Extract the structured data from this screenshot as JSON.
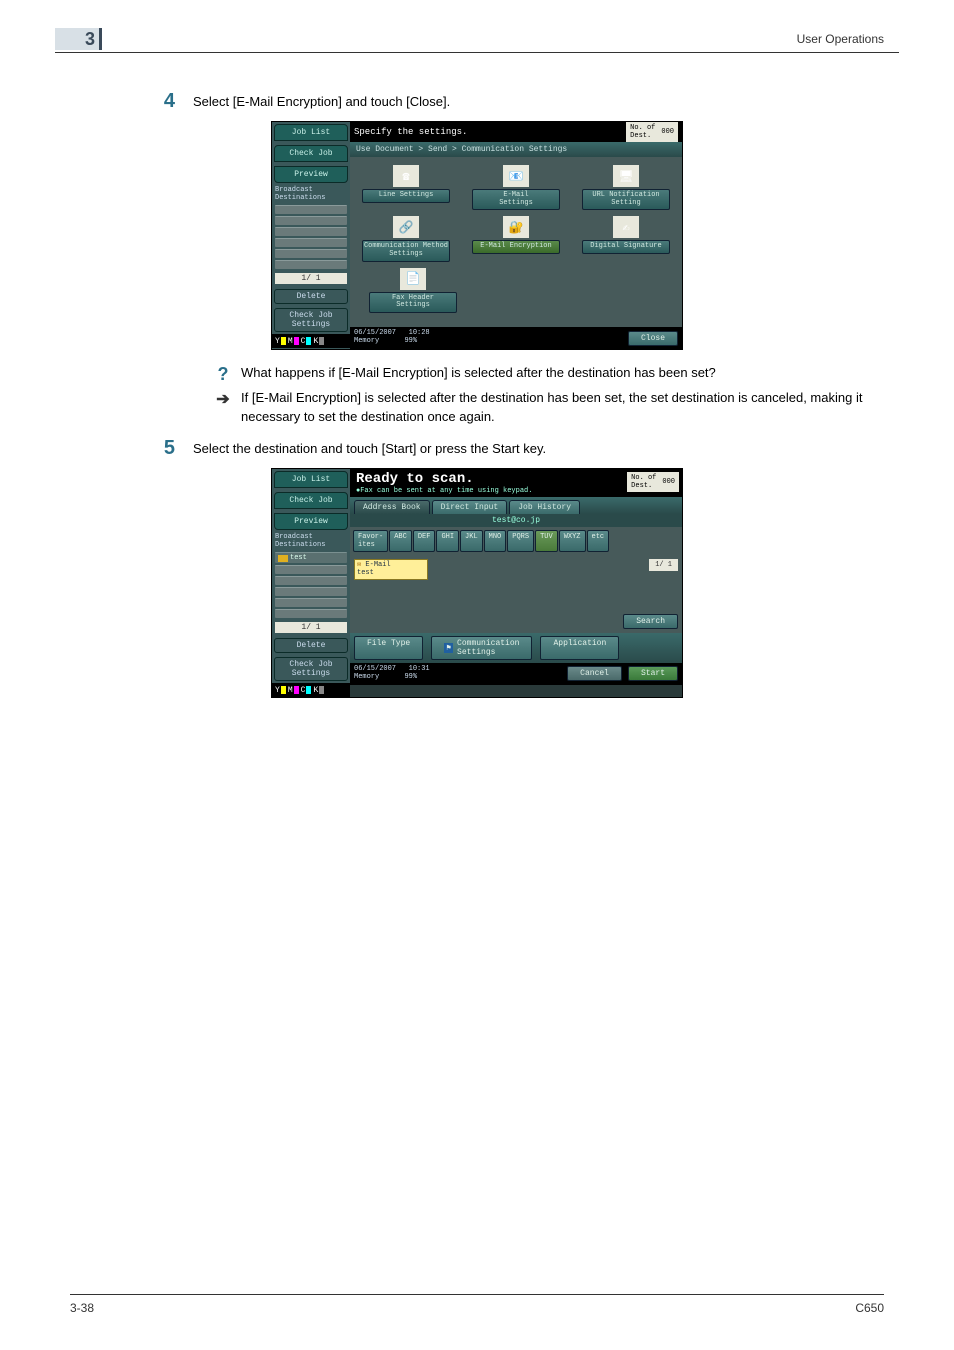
{
  "header": {
    "chapter_number": "3",
    "section_title": "User Operations"
  },
  "step4": {
    "number": "4",
    "text": "Select [E-Mail Encryption] and touch [Close]."
  },
  "screenshot1": {
    "sidebar": {
      "job_list": "Job List",
      "check_job": "Check Job",
      "preview": "Preview",
      "broadcast_label": "Broadcast\nDestinations",
      "page_indicator": "1/  1",
      "delete": "Delete",
      "check_job_settings": "Check Job\nSettings"
    },
    "topbar_title": "Specify the settings.",
    "dest_label": "No. of\nDest.",
    "dest_count": "000",
    "breadcrumb": "Use Document > Send > Communication Settings",
    "icons": {
      "line_settings": "Line Settings",
      "email_settings": "E-Mail\nSettings",
      "url_notif": "URL Notification\nSetting",
      "comm_method": "Communication Method\nSettings",
      "email_encryption": "E-Mail Encryption",
      "digital_signature": "Digital Signature",
      "fax_header": "Fax Header\nSettings"
    },
    "status": {
      "date": "06/15/2007",
      "time": "10:28",
      "memory_label": "Memory",
      "memory_pct": "99%"
    },
    "close": "Close",
    "cmyk": {
      "y": "Y",
      "m": "M",
      "c": "C",
      "k": "K"
    }
  },
  "qa": {
    "question": "What happens if [E-Mail Encryption] is selected after the destination has been set?",
    "answer": "If [E-Mail Encryption] is selected after the destination has been set, the set destination is canceled, making it necessary to set the destination once again."
  },
  "step5": {
    "number": "5",
    "text": "Select the destination and touch [Start] or press the Start key."
  },
  "screenshot2": {
    "sidebar": {
      "job_list": "Job List",
      "check_job": "Check Job",
      "preview": "Preview",
      "broadcast_label": "Broadcast\nDestinations",
      "dest_entry": "test",
      "page_indicator": "1/  1",
      "delete": "Delete",
      "check_job_settings": "Check Job\nSettings"
    },
    "ready_title": "Ready to scan.",
    "ready_sub": "●Fax can be sent at any time using keypad.",
    "dest_label": "No. of\nDest.",
    "dest_count": "000",
    "tabs": {
      "address_book": "Address Book",
      "direct_input": "Direct Input",
      "job_history": "Job History"
    },
    "search_host": "test@co.jp",
    "alpha": {
      "favor": "Favor-\nites",
      "abc": "ABC",
      "def": "DEF",
      "ghi": "GHI",
      "jkl": "JKL",
      "mno": "MNO",
      "pqrs": "PQRS",
      "tuv": "TUV",
      "wxyz": "WXYZ",
      "etc": "etc"
    },
    "result_chip_title": "E-Mail",
    "result_chip_name": "test",
    "page_indicator": "1/  1",
    "search_btn": "Search",
    "bottom": {
      "file_type": "File Type",
      "comm_settings": "Communication\nSettings",
      "application": "Application",
      "cancel": "Cancel",
      "start": "Start"
    },
    "status": {
      "date": "06/15/2007",
      "time": "10:31",
      "memory_label": "Memory",
      "memory_pct": "99%"
    }
  },
  "footer": {
    "page": "3-38",
    "model": "C650"
  }
}
